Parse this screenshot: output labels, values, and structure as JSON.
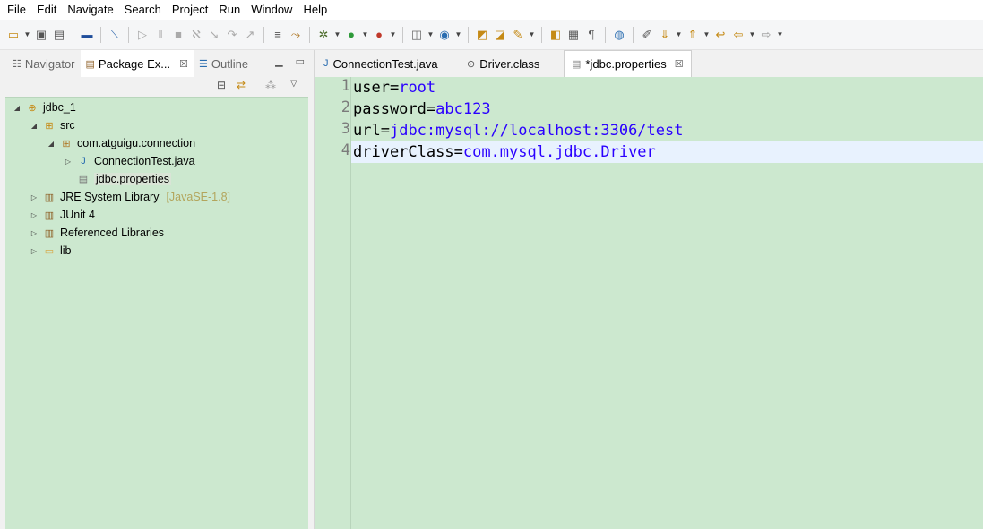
{
  "menu": [
    "File",
    "Edit",
    "Navigate",
    "Search",
    "Project",
    "Run",
    "Window",
    "Help"
  ],
  "left_panel": {
    "tabs": [
      {
        "label": "Navigator",
        "active": false
      },
      {
        "label": "Package Ex...",
        "active": true
      },
      {
        "label": "Outline",
        "active": false
      }
    ],
    "tree": [
      {
        "label": "jdbc_1",
        "icon": "project-icon"
      },
      {
        "label": "src",
        "icon": "source-folder-icon"
      },
      {
        "label": "com.atguigu.connection",
        "icon": "package-icon"
      },
      {
        "label": "ConnectionTest.java",
        "icon": "java-file-icon"
      },
      {
        "label": "jdbc.properties",
        "icon": "properties-file-icon"
      },
      {
        "label": "JRE System Library",
        "suffix": "[JavaSE-1.8]",
        "icon": "library-icon"
      },
      {
        "label": "JUnit 4",
        "icon": "library-icon"
      },
      {
        "label": "Referenced Libraries",
        "icon": "library-icon"
      },
      {
        "label": "lib",
        "icon": "folder-icon"
      }
    ]
  },
  "editor": {
    "tabs": [
      {
        "label": "ConnectionTest.java",
        "active": false
      },
      {
        "label": "Driver.class",
        "active": false
      },
      {
        "label": "*jdbc.properties",
        "active": true
      }
    ],
    "lines": [
      {
        "num": "1",
        "key": "user",
        "eq": "=",
        "value": "root"
      },
      {
        "num": "2",
        "key": "password",
        "eq": "=",
        "value": "abc123"
      },
      {
        "num": "3",
        "key": "url",
        "eq": "=",
        "value": "jdbc:mysql://localhost:3306/test"
      },
      {
        "num": "4",
        "key": "driverClass",
        "eq": "=",
        "value": "com.mysql.jdbc.Driver"
      }
    ]
  },
  "colors": {
    "editor_bg": "#cce8cf",
    "property_value": "#2a00ff",
    "current_line": "#e8f2fe"
  }
}
